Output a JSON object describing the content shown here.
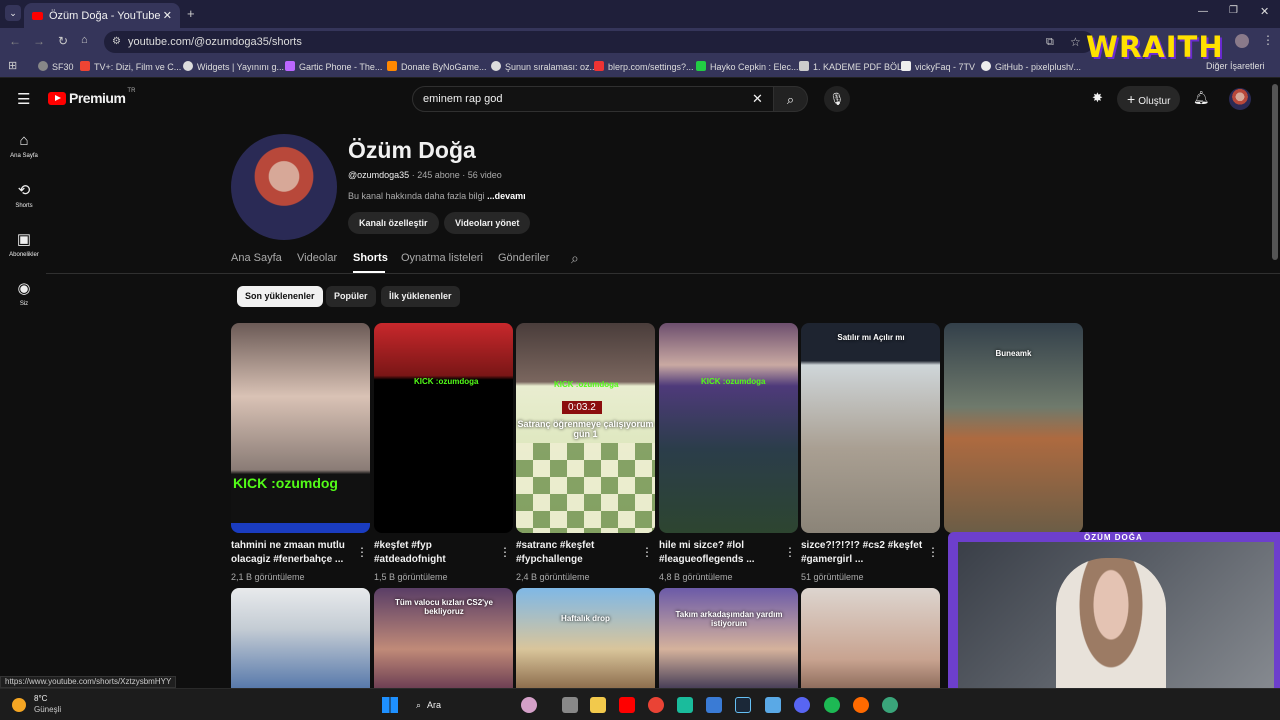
{
  "browser": {
    "tab_title": "Özüm Doğa - YouTube",
    "url": "youtube.com/@ozumdoga35/shorts",
    "bookmarks": [
      "SF30",
      "TV+: Dizi, Film ve C...",
      "Widgets | Yayınını g...",
      "Gartic Phone - The...",
      "Donate ByNoGame...",
      "Şunun sıralaması: oz...",
      "blerp.com/settings?...",
      "Hayko Cepkin : Elec...",
      "1. KADEME PDF BÖL...",
      "vickyFaq - 7TV",
      "GitHub - pixelplush/..."
    ],
    "bookmarks_overflow": "Diğer İşaretleri",
    "overlay_brand": "WRAITH"
  },
  "youtube": {
    "logo": "Premium",
    "logo_region": "TR",
    "search_value": "eminem rap god",
    "create_label": "Oluştur",
    "left_nav": [
      {
        "label": "Ana Sayfa",
        "icon": "home-icon"
      },
      {
        "label": "Shorts",
        "icon": "shorts-icon"
      },
      {
        "label": "Abonelikler",
        "icon": "subscriptions-icon"
      },
      {
        "label": "Siz",
        "icon": "you-icon"
      }
    ]
  },
  "channel": {
    "name": "Özüm Doğa",
    "handle": "@ozumdoga35",
    "subscribers": "245 abone",
    "videos": "56 video",
    "description": "Bu kanal hakkında daha fazla bilgi",
    "more": "...devamı",
    "customize_btn": "Kanalı özelleştir",
    "manage_btn": "Videoları yönet",
    "tabs": [
      "Ana Sayfa",
      "Videolar",
      "Shorts",
      "Oynatma listeleri",
      "Gönderiler"
    ],
    "active_tab": "Shorts",
    "chips": [
      "Son yüklenenler",
      "Popüler",
      "İlk yüklenenler"
    ]
  },
  "shorts": [
    {
      "title": "tahmini ne zmaan mutlu olacagiz #fenerbahçe ...",
      "views": "2,1 B görüntüleme",
      "overlay": "KICK :ozumdog"
    },
    {
      "title": "#keşfet #fyp #atdeadofnight",
      "views": "1,5 B görüntüleme",
      "overlay": "KICK :ozumdoga"
    },
    {
      "title": "#satranc #keşfet #fypchallenge",
      "views": "2,4 B görüntüleme",
      "overlay": "Satranç öğrenmeye çalışıyorum gün 1",
      "timer": "0:03.2",
      "kick": "KICK :ozumdoga"
    },
    {
      "title": "hile mi sizce? #lol #leagueoflegends ...",
      "views": "4,8 B görüntüleme",
      "overlay": "KICK :ozumdoga"
    },
    {
      "title": "sizce?!?!?!? #cs2 #keşfet #gamergirl ...",
      "views": "51 görüntüleme",
      "overlay": "Satılır mı Açılır mı"
    },
    {
      "title": "",
      "views": "",
      "overlay": "Buneamk"
    }
  ],
  "shorts_row2": [
    {
      "overlay": ""
    },
    {
      "overlay": "Tüm valocu kızları CS2'ye bekliyoruz"
    },
    {
      "overlay": "Haftalık drop"
    },
    {
      "overlay": "Takım arkadaşımdan yardım istiyorum"
    },
    {
      "overlay": ""
    }
  ],
  "webcam_label": "ÖZÜM DOĞA",
  "status_url": "https://www.youtube.com/shorts/XztzysbmHYY",
  "taskbar": {
    "temperature": "8°C",
    "weather": "Güneşli",
    "search_placeholder": "Ara"
  }
}
